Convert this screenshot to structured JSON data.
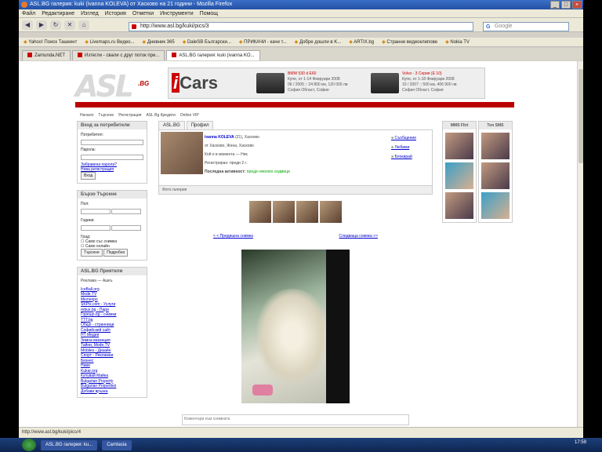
{
  "window": {
    "title": "ASL.BG галерия: kuki (ivanna KOLEVA) от Хасково на 21 години - Mozilla Firefox",
    "buttons": [
      "_",
      "□",
      "×"
    ]
  },
  "menu": [
    "Файл",
    "Редактиране",
    "Изглед",
    "История",
    "Отметки",
    "Инструменти",
    "Помощ"
  ],
  "toolbar": {
    "nav_icons": [
      "back-icon",
      "forward-icon",
      "reload-icon",
      "stop-icon",
      "home-icon"
    ],
    "url": "http://www.asl.bg/kuki/pics/3",
    "search_engine": "G",
    "search_placeholder": "Google"
  },
  "bookmarks": [
    "Yahoo! Поиск Ташкент",
    "Livemaps.ru Видео...",
    "Дневник 365",
    "DaleSB Български...",
    "ПРИКАЧИ - качи т...",
    "Добре дошли в K...",
    "ARTIX.bg",
    "Странни видеоклипове",
    "Nokia TV"
  ],
  "tabs": [
    {
      "label": "Zamunda.NET",
      "active": false
    },
    {
      "label": "Изтегли - свали с друг поток при...",
      "active": false
    },
    {
      "label": "ASL.BG галерия: kuki (ivanna KO...",
      "active": true
    }
  ],
  "site": {
    "logo_text": "ASL",
    "logo_sub": ".BG",
    "banner_brand": "Cars",
    "banner_brand_prefix": "i",
    "ad1_title": "BMW 530 d E60",
    "ad1_line1": "Купе, от 1-14 Февруари 2008",
    "ad1_line2": "06 / 2005 :: 24 800 км, 120 000 лв",
    "ad1_line3": "София Област, София",
    "ad2_title": "Volvo - 3 Серия (E 10)",
    "ad2_line1": "Купе, от 1-18 Февруари 2008",
    "ad2_line2": "10 / 2007 :: 500 км, 406 900 лв",
    "ad2_line3": "София Област, София",
    "top_links": [
      "Начало",
      "Търсене",
      "Регистрация",
      "ASL Bg Кредити",
      "Online VIP"
    ]
  },
  "left": {
    "login_title": "Вход за потребители",
    "login_user_label": "Потребител:",
    "login_pass_label": "Парола:",
    "login_forgot": "Забравена парола?",
    "login_register": "Нова регистрация",
    "login_button": "Вход",
    "search_title": "Бързо Търсене",
    "search_gender_label": "Пол:",
    "search_age_label": "Години:",
    "search_city_label": "Град:",
    "search_photo_label": "Само със снимка",
    "search_online_label": "Само онлайн",
    "search_button": "Търсене",
    "advanced_button": "Подробно",
    "partners_title": "ASL.BG Приятели",
    "partners_banner": "Реклама — Ашкъ",
    "partners": [
      "IceBall.org",
      "Mode.TV",
      "Mionexpo",
      "SKPix.com - Услуги",
      "rebux.bg - Пари",
      "Горещо.bg - снимки",
      "TTT.bg",
      "Общо - странници",
      "Софийский сайт",
      "HT Медия",
      "Зимна ваканция",
      "Тайни, Mode.TV",
      "Mobiles - Дизайн",
      "Спорт - Рекламни",
      "Бизнес",
      "Нави",
      "Kukar.org",
      "Купувай Майка",
      "Bulgarian Property",
      "Bulgarian Properties",
      "Добави връзка"
    ]
  },
  "profile": {
    "tab1": "ASL.BG",
    "tab2": "Профил",
    "name": "ivanna KOLEVA",
    "age_suffix": "(21), Хасково",
    "line2": "от Хасково, Жена, Хасково",
    "line3": "Кой е в момента — Ниє",
    "line4": "Регистриран: преди 2 г.",
    "last_active_label": "Последна активност:",
    "last_active_value": "преди няколко седмици",
    "actions": [
      "Съобщение",
      "Любими",
      "Блокирай"
    ],
    "gallery_label": "Фото галерия",
    "prev_link": "< < Предишна снимка",
    "next_link": "Следваща снимка >>",
    "comment_label": "Коментари към снимката"
  },
  "right": {
    "box1_title": "MMS Flirt",
    "box2_title": "Топ SMS"
  },
  "status": {
    "text": "http://www.asl.bg/kuki/pics/4"
  },
  "taskbar": {
    "items": [
      "ASL.BG галерия: ku...",
      "Camtasia"
    ],
    "clock": "17:59"
  }
}
